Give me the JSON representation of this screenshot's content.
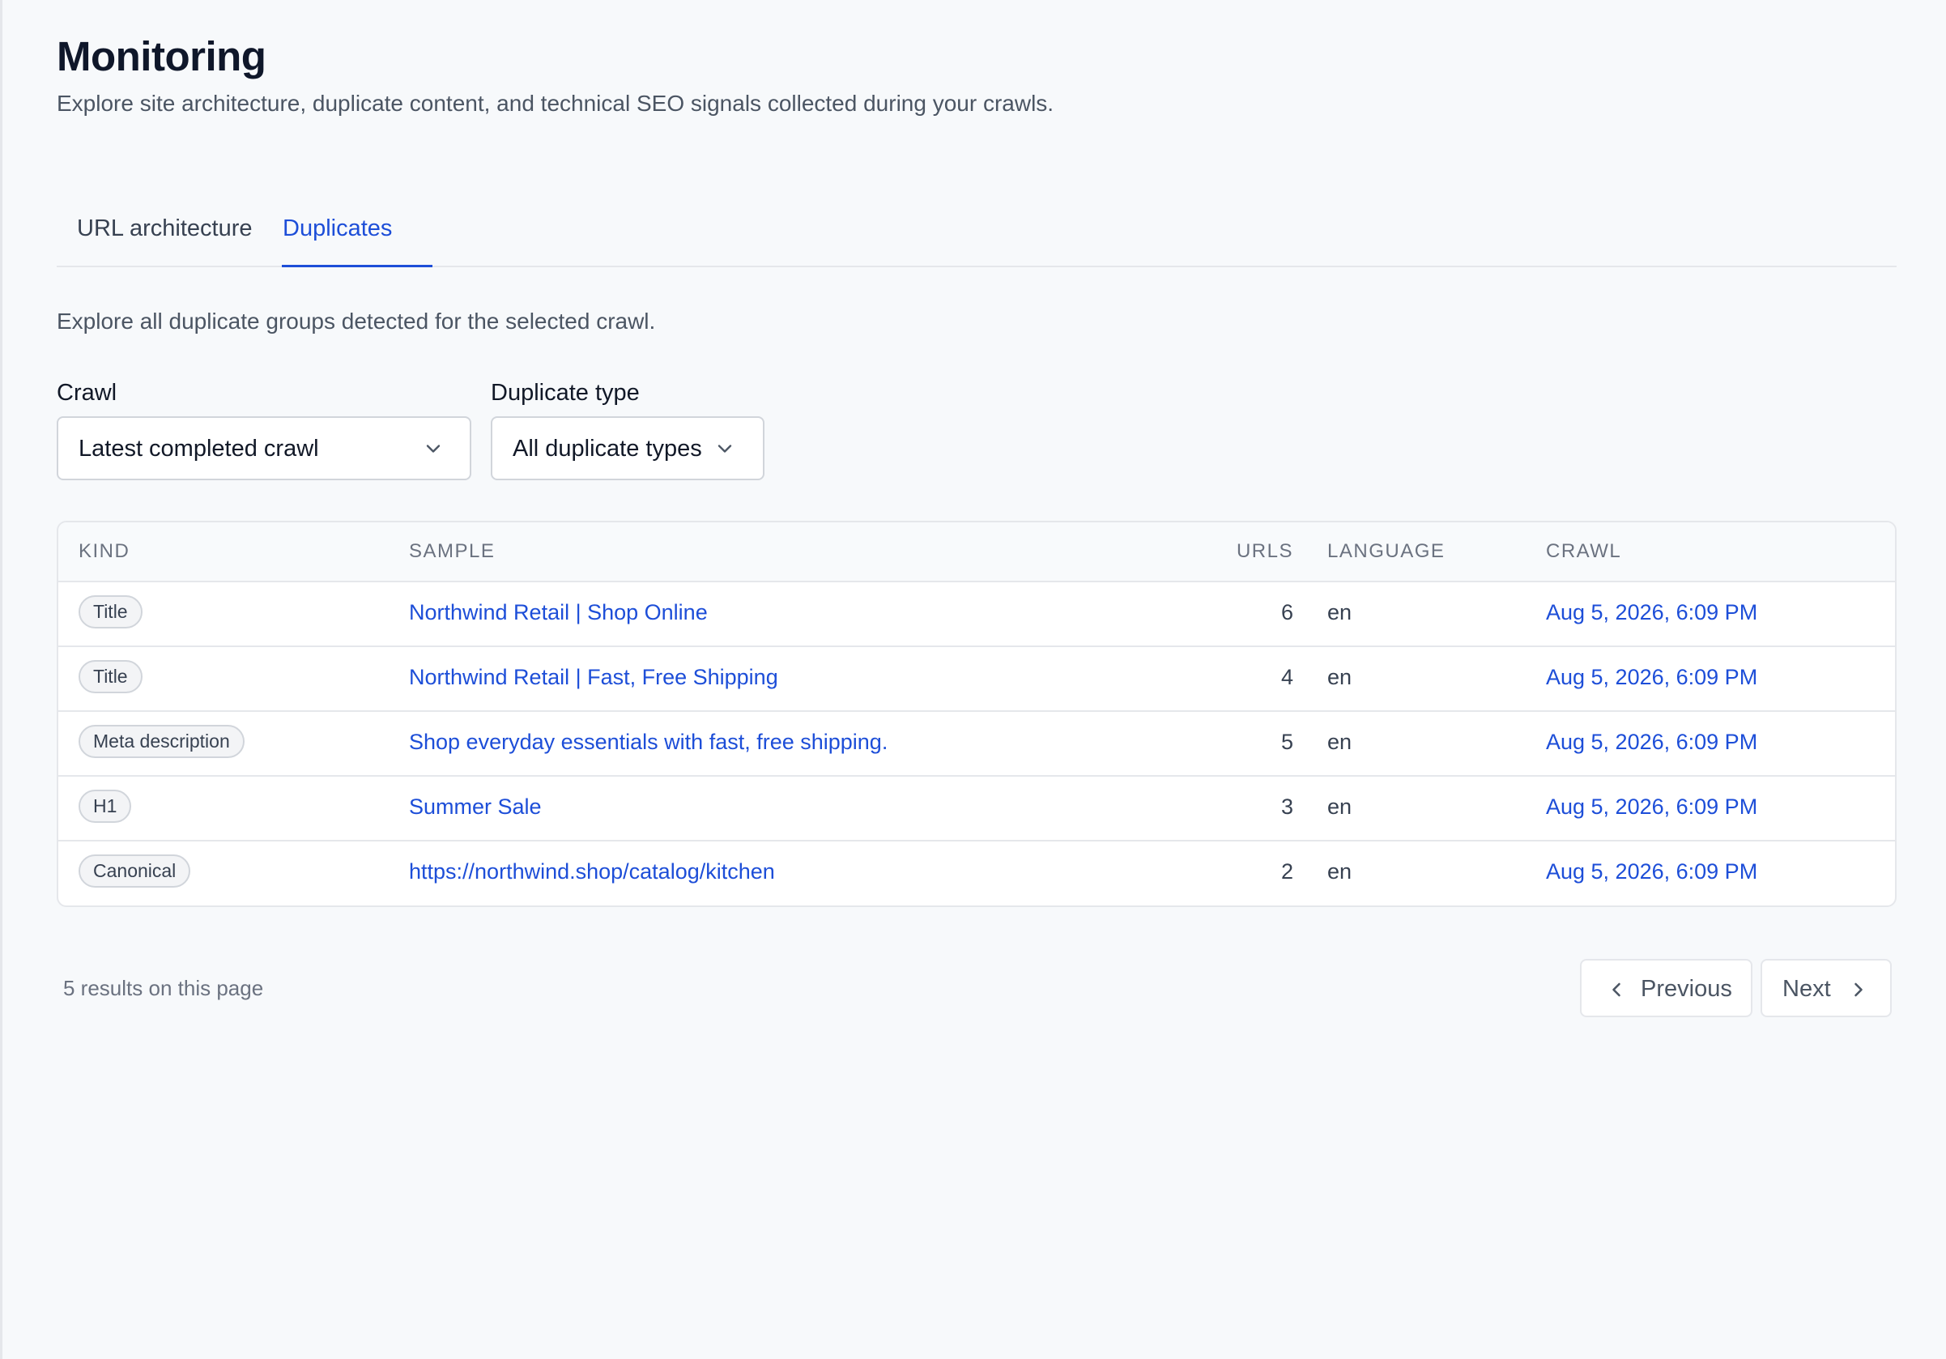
{
  "header": {
    "title": "Monitoring",
    "subtitle": "Explore site architecture, duplicate content, and technical SEO signals collected during your crawls."
  },
  "tabs": [
    {
      "label": "URL architecture",
      "active": false
    },
    {
      "label": "Duplicates",
      "active": true
    }
  ],
  "duplicates": {
    "description": "Explore all duplicate groups detected for the selected crawl.",
    "filters": {
      "crawl": {
        "label": "Crawl",
        "value": "Latest completed crawl"
      },
      "duplicate_type": {
        "label": "Duplicate type",
        "value": "All duplicate types"
      }
    },
    "table": {
      "columns": [
        "KIND",
        "SAMPLE",
        "URLS",
        "LANGUAGE",
        "CRAWL"
      ],
      "rows": [
        {
          "kind": "Title",
          "sample": "Northwind Retail | Shop Online",
          "urls": "6",
          "language": "en",
          "crawl": "Aug 5, 2026, 6:09 PM"
        },
        {
          "kind": "Title",
          "sample": "Northwind Retail | Fast, Free Shipping",
          "urls": "4",
          "language": "en",
          "crawl": "Aug 5, 2026, 6:09 PM"
        },
        {
          "kind": "Meta description",
          "sample": "Shop everyday essentials with fast, free shipping.",
          "urls": "5",
          "language": "en",
          "crawl": "Aug 5, 2026, 6:09 PM"
        },
        {
          "kind": "H1",
          "sample": "Summer Sale",
          "urls": "3",
          "language": "en",
          "crawl": "Aug 5, 2026, 6:09 PM"
        },
        {
          "kind": "Canonical",
          "sample": "https://northwind.shop/catalog/kitchen",
          "urls": "2",
          "language": "en",
          "crawl": "Aug 5, 2026, 6:09 PM"
        }
      ]
    },
    "pagination": {
      "results_text": "5 results on this page",
      "previous_label": "Previous",
      "next_label": "Next"
    }
  },
  "icons": {
    "select_chevron": "chevron-down-icon",
    "previous": "chevron-left-icon",
    "next": "chevron-right-icon"
  },
  "colors": {
    "accent": "#1d4ed8",
    "background": "#f7f9fb",
    "border": "#e5e7eb",
    "text_primary": "#111827",
    "text_muted": "#6b7280"
  }
}
